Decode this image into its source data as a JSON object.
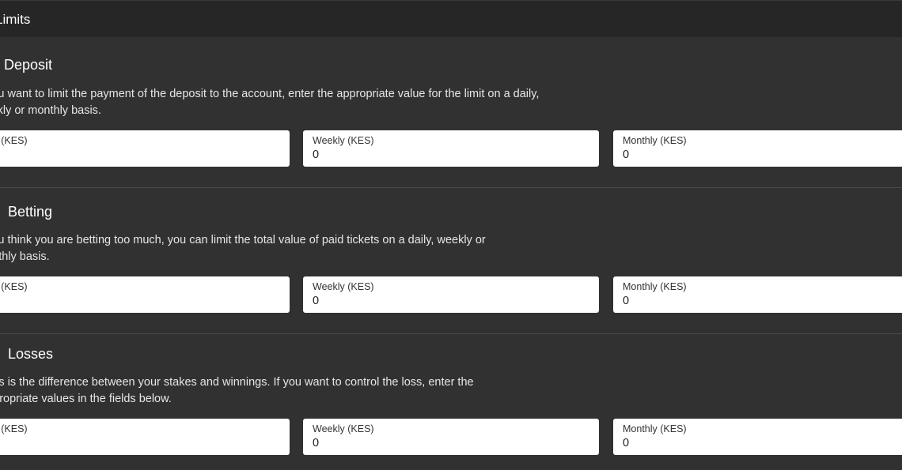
{
  "header": {
    "title": "Limits"
  },
  "sections": [
    {
      "title": "Deposit",
      "description": "If you want to limit the payment of the deposit to the account, enter the appropriate value for the limit on a daily, weekly or monthly basis.",
      "fields": [
        {
          "label": "Daily (KES)",
          "value": ""
        },
        {
          "label": "Weekly (KES)",
          "value": "0"
        },
        {
          "label": "Monthly (KES)",
          "value": "0"
        }
      ]
    },
    {
      "title": "Betting",
      "description": "If you think you are betting too much, you can limit the total value of paid tickets on a daily, weekly or monthly basis.",
      "fields": [
        {
          "label": "Daily (KES)",
          "value": ""
        },
        {
          "label": "Weekly (KES)",
          "value": "0"
        },
        {
          "label": "Monthly (KES)",
          "value": "0"
        }
      ]
    },
    {
      "title": "Losses",
      "description": "Loss is the difference between your stakes and winnings. If you want to control the loss, enter the appropriate values in the fields below.",
      "fields": [
        {
          "label": "Daily (KES)",
          "value": ""
        },
        {
          "label": "Weekly (KES)",
          "value": "0"
        },
        {
          "label": "Monthly (KES)",
          "value": "0"
        }
      ]
    }
  ],
  "colors": {
    "background": "#313131",
    "header_background": "#262626",
    "field_background": "#ffffff",
    "divider": "#4a4a4a"
  }
}
